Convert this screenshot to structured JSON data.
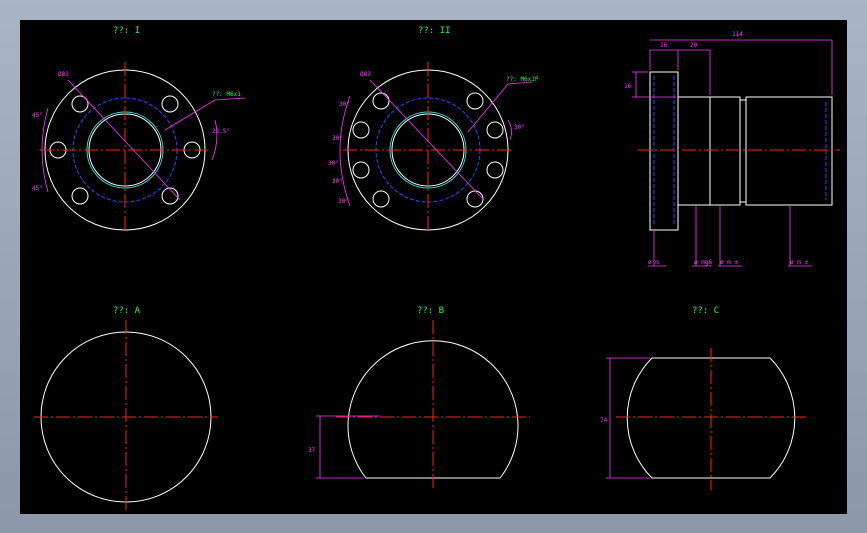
{
  "views": {
    "v1_title": "??: I",
    "v2_title": "??: II",
    "va_title": "??: A",
    "vb_title": "??: B",
    "vc_title": "??: C"
  },
  "dims": {
    "v1_dia": "Ø83",
    "v1_thread": "??: M6x1",
    "v1_angle_top": "45°",
    "v1_angle_bot": "45°",
    "v1_angle_side": "22.5°",
    "v2_dia": "Ø83",
    "v2_thread": "??: M6x1P",
    "v2_a1": "30°",
    "v2_a2": "30°",
    "v2_a3": "30°",
    "v2_a4": "30°",
    "v2_a5": "30°",
    "v2_a6": "30°",
    "side_total": "114",
    "side_d1": "16",
    "side_d2": "20",
    "side_d3": "16",
    "side_l1": "ø m",
    "side_l2": "ø mg6",
    "side_l3": "ø m ±",
    "side_l4": "ø m ±",
    "vb_dim": "37",
    "vc_dim": "74"
  }
}
